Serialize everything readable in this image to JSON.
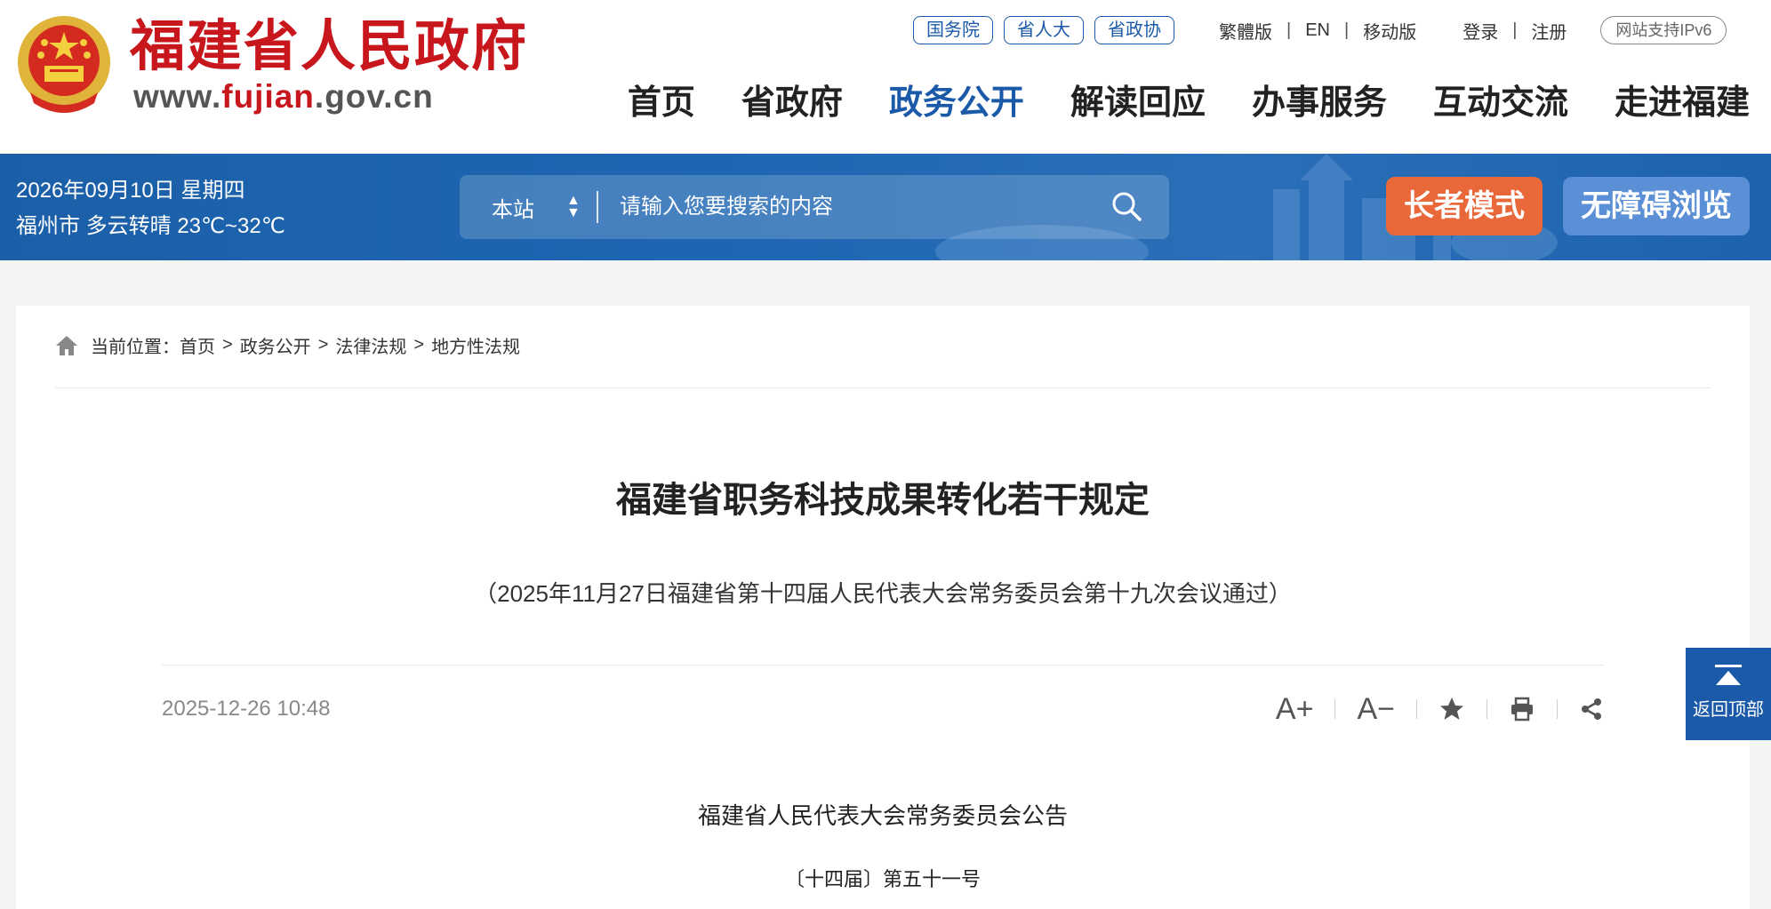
{
  "header": {
    "site_title": "福建省人民政府",
    "url_prefix": "www.",
    "url_domain": "fujian",
    "url_suffix": ".gov.cn",
    "pills": [
      "国务院",
      "省人大",
      "省政协"
    ],
    "lang_links": [
      "繁體版",
      "EN",
      "移动版"
    ],
    "login": "登录",
    "register": "注册",
    "ipv6": "网站支持IPv6",
    "nav": [
      "首页",
      "省政府",
      "政务公开",
      "解读回应",
      "办事服务",
      "互动交流",
      "走进福建"
    ],
    "active_nav": "政务公开"
  },
  "band": {
    "date": "2026年09月10日 星期四",
    "weather": "福州市 多云转晴 23℃~32℃",
    "search_scope": "本站",
    "search_placeholder": "请输入您要搜索的内容",
    "elder_mode": "长者模式",
    "accessible": "无障碍浏览"
  },
  "breadcrumb": {
    "prefix": "当前位置：",
    "items": [
      "首页",
      "政务公开",
      "法律法规",
      "地方性法规"
    ]
  },
  "article": {
    "title": "福建省职务科技成果转化若干规定",
    "subtitle": "（2025年11月27日福建省第十四届人民代表大会常务委员会第十九次会议通过）",
    "publish_time": "2025-12-26 10:48",
    "tools": {
      "font_larger": "A+",
      "font_smaller": "A−"
    },
    "body_heading": "福建省人民代表大会常务委员会公告",
    "body_number": "〔十四届〕第五十一号"
  },
  "back_to_top": "返回顶部",
  "colors": {
    "brand_red": "#c8161d",
    "brand_blue": "#1a5aa8",
    "elder_orange": "#e9683a",
    "access_blue": "#5b8fd6"
  }
}
